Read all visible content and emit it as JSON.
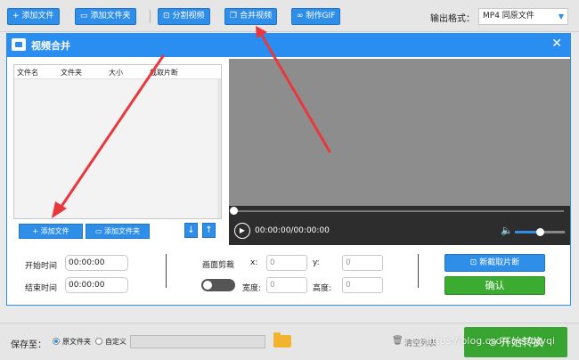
{
  "toolbar": {
    "add_file": "添加文件",
    "add_folder": "添加文件夹",
    "split_video": "分割视频",
    "merge_video": "合并视频",
    "make_gif": "制作GIF",
    "output_label": "输出格式：",
    "output_value": "MP4  同原文件"
  },
  "dialog": {
    "title": "视频合并",
    "close": "✕",
    "file_list": {
      "columns": [
        "文件名",
        "文件夹",
        "大小",
        "截取片断"
      ]
    },
    "add_file": "添加文件",
    "add_folder": "添加文件夹",
    "move_down": "↓",
    "move_up": "↑",
    "player": {
      "time": "00:00:00/00:00:00",
      "volume": 0.5
    },
    "trim": {
      "start_label": "开始时间",
      "start_value": "00:00:00",
      "end_label": "结束时间",
      "end_value": "00:00:00"
    },
    "crop": {
      "title": "画面剪裁",
      "x_label": "x:",
      "x_value": "0",
      "y_label": "y:",
      "y_value": "0",
      "width_label": "宽度:",
      "width_value": "0",
      "height_label": "高度:",
      "height_value": "0"
    },
    "new_clip": "新截取片断",
    "confirm": "确认"
  },
  "bottom": {
    "save_label": "保存至：",
    "opt_source": "原文件夹",
    "opt_custom": "自定义",
    "path_value": "",
    "clear_list": "清空列表",
    "start": "开始转换"
  },
  "watermark": "https://blog.csdn.net/tyyqi",
  "colors": {
    "accent": "#2a8ef0",
    "confirm": "#3cab32",
    "annotation": "#e8383d"
  }
}
